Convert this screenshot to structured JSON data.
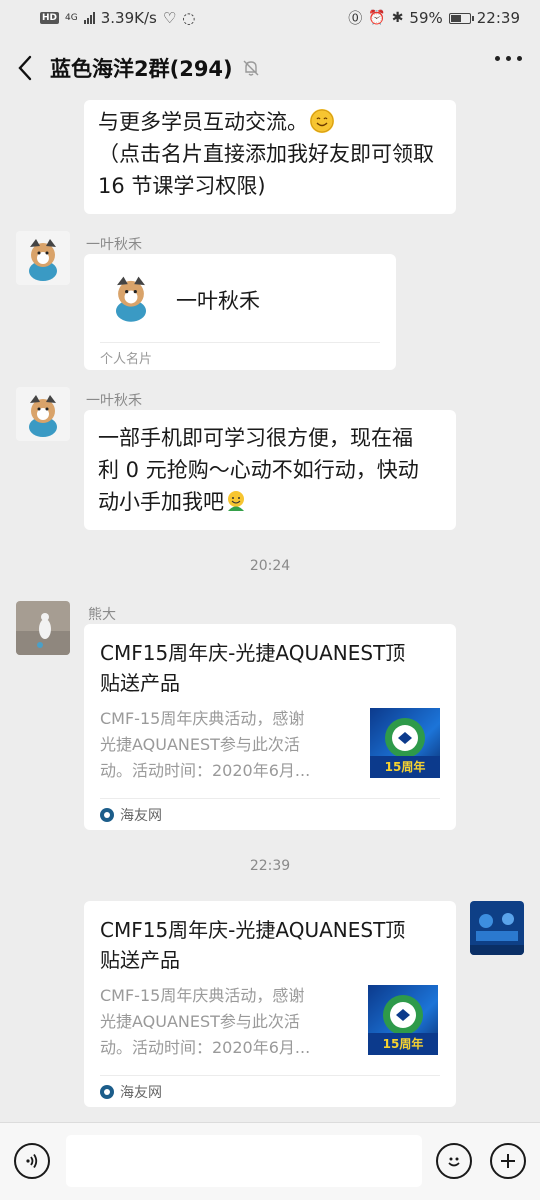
{
  "status": {
    "badge": "HD",
    "network": "4G",
    "speed": "3.39K/s",
    "battery": "59%",
    "battery_level": 0.59,
    "time": "22:39"
  },
  "nav": {
    "title": "蓝色海洋2群(294)"
  },
  "messages": {
    "m1_line1": "与更多学员互动交流。",
    "m1_line2": "（点击名片直接添加我好友即可领取",
    "m1_line3": "16 节课学习权限)",
    "contact_sender": "一叶秋禾",
    "contact_name": "一叶秋禾",
    "contact_label": "个人名片",
    "m3_sender": "一叶秋禾",
    "m3_line1": "一部手机即可学习很方便，现在福",
    "m3_line2": "利 0 元抢购～心动不如行动，快动",
    "m3_line3": "动小手加我吧",
    "time1": "20:24",
    "link1_sender": "熊大",
    "link1_title_l1": "CMF15周年庆-光捷AQUANEST顶",
    "link1_title_l2": "贴送产品",
    "link1_desc_l1": "CMF-15周年庆典活动，感谢",
    "link1_desc_l2": "光捷AQUANEST参与此次活",
    "link1_desc_l3": "动。活动时间：2020年6月...",
    "link1_source": "海友网",
    "time2": "22:39",
    "link2_title_l1": "CMF15周年庆-光捷AQUANEST顶",
    "link2_title_l2": "贴送产品",
    "link2_desc_l1": "CMF-15周年庆典活动，感谢",
    "link2_desc_l2": "光捷AQUANEST参与此次活",
    "link2_desc_l3": "动。活动时间：2020年6月...",
    "link2_source": "海友网",
    "thumb_badge": "15周年"
  },
  "colors": {
    "bg": "#ededed",
    "bubble": "#ffffff",
    "thumb": "#1c74d8"
  }
}
